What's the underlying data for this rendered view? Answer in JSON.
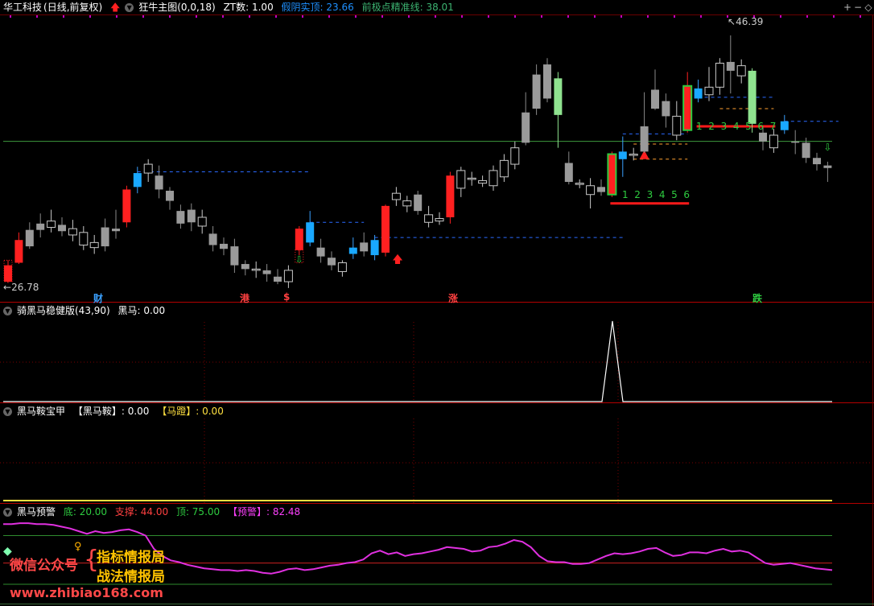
{
  "main": {
    "stock": "华工科技",
    "period": "(日线,前复权)",
    "indicator": "狂牛主图(0,0,18)",
    "zt_label": "ZT数: 1.00",
    "false_yin_label": "假阴实顶: 23.66",
    "pivot_label": "前极点精准线: 38.01",
    "high_label": "46.39",
    "low_label": "26.78",
    "markers": [
      "财",
      "港",
      "$",
      "涨",
      "跌"
    ],
    "count_left": [
      "1",
      "2",
      "3",
      "4",
      "5",
      "6"
    ],
    "count_right": [
      "1",
      "2",
      "3",
      "4",
      "5",
      "6",
      "7"
    ],
    "colors": {
      "up": "#ff2020",
      "down": "#9a9a9a",
      "cyan": "#19a8ff",
      "green": "#8fe38f",
      "grid": "#a00000"
    },
    "candles": [
      [
        28.2,
        26.9,
        28.6,
        26.8,
        "r"
      ],
      [
        30.2,
        28.4,
        30.8,
        28.3,
        "r"
      ],
      [
        31.0,
        29.7,
        31.6,
        29.5,
        "k"
      ],
      [
        31.5,
        31.0,
        32.3,
        30.4,
        "k"
      ],
      [
        31.2,
        31.7,
        32.6,
        30.8,
        "k"
      ],
      [
        31.4,
        30.9,
        32.0,
        30.5,
        "k"
      ],
      [
        30.6,
        31.1,
        31.8,
        30.1,
        "k"
      ],
      [
        29.8,
        30.8,
        31.3,
        29.4,
        "k"
      ],
      [
        29.6,
        30.0,
        30.6,
        29.1,
        "k"
      ],
      [
        31.2,
        29.7,
        31.9,
        29.3,
        "k"
      ],
      [
        31.1,
        30.9,
        32.6,
        30.3,
        "k"
      ],
      [
        34.2,
        31.6,
        34.5,
        31.2,
        "r"
      ],
      [
        35.5,
        34.4,
        36.0,
        33.9,
        "c"
      ],
      [
        35.5,
        36.2,
        36.6,
        34.8,
        "k"
      ],
      [
        35.3,
        34.2,
        36.1,
        33.5,
        "k"
      ],
      [
        34.1,
        33.3,
        34.4,
        32.6,
        "k"
      ],
      [
        32.5,
        31.5,
        33.0,
        31.1,
        "k"
      ],
      [
        32.6,
        31.6,
        33.1,
        30.9,
        "k"
      ],
      [
        31.3,
        32.0,
        32.6,
        30.7,
        "k"
      ],
      [
        30.7,
        29.8,
        31.3,
        29.3,
        "k"
      ],
      [
        29.9,
        29.5,
        30.4,
        29.0,
        "k"
      ],
      [
        29.7,
        28.2,
        30.3,
        27.6,
        "k"
      ],
      [
        28.3,
        27.9,
        28.6,
        27.4,
        "k"
      ],
      [
        27.8,
        27.9,
        28.5,
        27.2,
        "k"
      ],
      [
        27.8,
        27.5,
        28.3,
        26.9,
        "k"
      ],
      [
        27.3,
        26.9,
        27.9,
        26.7,
        "k"
      ],
      [
        26.9,
        27.8,
        28.2,
        26.4,
        "k"
      ],
      [
        29.4,
        31.1,
        31.3,
        29.0,
        "r"
      ],
      [
        30.0,
        31.6,
        32.5,
        29.7,
        "c"
      ],
      [
        29.6,
        28.9,
        30.3,
        28.4,
        "k"
      ],
      [
        28.8,
        28.2,
        29.3,
        27.8,
        "k"
      ],
      [
        27.7,
        28.4,
        28.6,
        27.3,
        "k"
      ],
      [
        29.6,
        29.1,
        30.4,
        28.7,
        "c"
      ],
      [
        30.0,
        29.3,
        30.8,
        28.9,
        "k"
      ],
      [
        30.2,
        29.0,
        30.6,
        28.6,
        "c"
      ],
      [
        32.9,
        29.2,
        33.0,
        28.9,
        "r"
      ],
      [
        33.4,
        33.9,
        34.4,
        32.9,
        "k"
      ],
      [
        32.9,
        33.3,
        33.7,
        32.4,
        "k"
      ],
      [
        33.8,
        32.5,
        34.1,
        32.2,
        "k"
      ],
      [
        31.6,
        32.2,
        32.9,
        31.2,
        "k"
      ],
      [
        31.7,
        31.9,
        32.4,
        31.4,
        "k"
      ],
      [
        35.3,
        32.0,
        35.6,
        31.5,
        "r"
      ],
      [
        34.3,
        35.7,
        36.0,
        33.6,
        "k"
      ],
      [
        35.0,
        35.1,
        35.6,
        34.5,
        "k"
      ],
      [
        34.7,
        34.9,
        35.3,
        34.4,
        "k"
      ],
      [
        34.5,
        35.7,
        36.1,
        34.1,
        "k"
      ],
      [
        35.2,
        36.5,
        37.0,
        34.8,
        "k"
      ],
      [
        36.2,
        37.5,
        38.0,
        35.8,
        "k"
      ],
      [
        40.3,
        37.9,
        41.9,
        37.7,
        "k"
      ],
      [
        43.3,
        40.6,
        44.1,
        40.1,
        "k"
      ],
      [
        44.1,
        41.4,
        44.6,
        41.1,
        "k"
      ],
      [
        40.1,
        43.0,
        43.5,
        37.5,
        "g"
      ],
      [
        36.3,
        34.8,
        37.2,
        34.6,
        "k"
      ],
      [
        34.6,
        34.7,
        35.0,
        34.3,
        "k"
      ],
      [
        33.8,
        34.5,
        35.1,
        32.7,
        "k"
      ],
      [
        34.4,
        34.0,
        35.0,
        33.7,
        "k"
      ],
      [
        33.8,
        37.0,
        37.2,
        33.6,
        "rg"
      ],
      [
        37.2,
        36.6,
        38.4,
        35.2,
        "c"
      ],
      [
        36.9,
        37.0,
        37.5,
        36.5,
        "k"
      ],
      [
        39.2,
        37.2,
        41.9,
        37.1,
        "k"
      ],
      [
        42.1,
        40.6,
        43.7,
        40.5,
        "k"
      ],
      [
        41.2,
        40.0,
        41.8,
        39.1,
        "k"
      ],
      [
        38.5,
        40.0,
        41.2,
        38.1,
        "k"
      ],
      [
        38.9,
        42.4,
        43.5,
        38.7,
        "gr"
      ],
      [
        41.4,
        42.2,
        42.9,
        41.1,
        "c"
      ],
      [
        41.7,
        42.3,
        43.9,
        41.2,
        "k"
      ],
      [
        42.3,
        44.2,
        44.6,
        41.7,
        "k"
      ],
      [
        44.3,
        43.6,
        46.4,
        41.8,
        "k"
      ],
      [
        43.2,
        44.0,
        44.5,
        42.6,
        "k"
      ],
      [
        43.6,
        39.4,
        43.8,
        38.7,
        "g"
      ],
      [
        38.7,
        38.0,
        39.1,
        37.3,
        "k"
      ],
      [
        37.5,
        38.5,
        39.0,
        37.1,
        "k"
      ],
      [
        38.9,
        39.6,
        40.1,
        38.6,
        "c"
      ],
      [
        38.0,
        37.9,
        38.9,
        37.0,
        "k"
      ],
      [
        37.9,
        36.7,
        38.3,
        36.3,
        "k"
      ],
      [
        36.7,
        36.2,
        37.1,
        35.7,
        "k"
      ],
      [
        36.1,
        35.9,
        36.4,
        34.8,
        "k"
      ]
    ]
  },
  "panel1": {
    "name": "骑黑马稳健版(43,90)",
    "value_label": "黑马: 0.00"
  },
  "panel2": {
    "name": "黑马鞍宝甲",
    "saddle_label": "【黑马鞍】: 0.00",
    "stirrup_label": "【马蹬】: 0.00"
  },
  "panel3": {
    "name": "黑马预警",
    "bottom_label": "底: 20.00",
    "support_label": "支撑: 44.00",
    "top_label": "顶: 75.00",
    "alert_label": "【预警】: 82.48",
    "line": [
      88,
      88,
      89,
      89,
      88,
      88,
      87,
      85,
      83,
      80,
      77,
      80,
      78,
      79,
      81,
      82,
      79,
      75,
      60,
      52,
      47,
      45,
      42,
      40,
      38,
      37,
      36,
      36,
      35,
      36,
      35,
      33,
      32,
      34,
      37,
      38,
      36,
      37,
      39,
      41,
      42,
      44,
      45,
      48,
      55,
      58,
      54,
      56,
      52,
      54,
      55,
      57,
      59,
      62,
      61,
      60,
      57,
      58,
      62,
      63,
      66,
      70,
      68,
      62,
      52,
      46,
      45,
      45,
      43,
      43,
      44,
      48,
      52,
      55,
      54,
      55,
      57,
      60,
      61,
      56,
      52,
      53,
      56,
      56,
      55,
      58,
      60,
      57,
      58,
      56,
      50,
      44,
      42,
      43,
      44,
      42,
      40,
      38,
      37,
      36
    ]
  },
  "watermark": {
    "wechat": "微信公众号",
    "line1": "指标情报局",
    "line2": "战法情报局",
    "url": "www.zhibiao168.com"
  },
  "window_controls": [
    "+",
    "−",
    "◇"
  ]
}
